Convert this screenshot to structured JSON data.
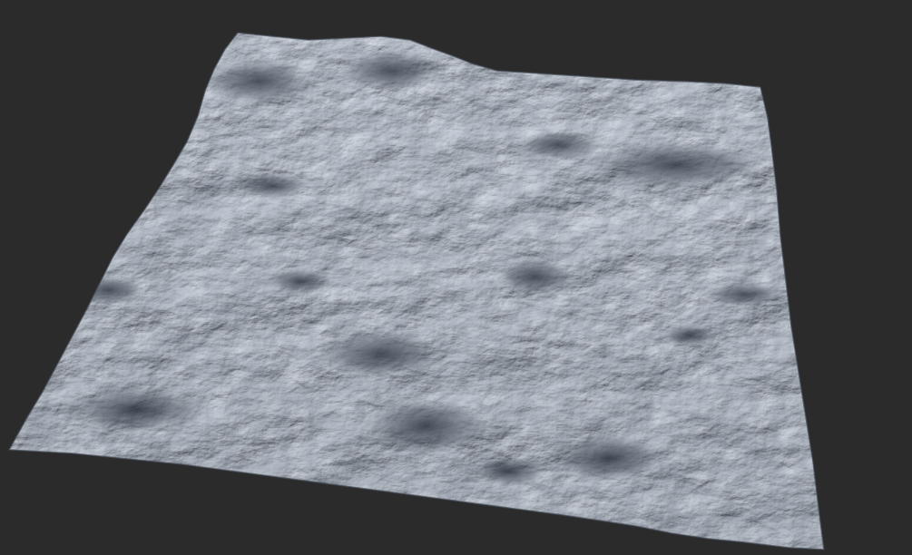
{
  "viewport": {
    "background": "#2b2b2b",
    "terrain_base_color": "#a9b0b8",
    "terrain_highlight_color": "#d4d9de",
    "terrain_shadow_color": "#3e4652"
  }
}
